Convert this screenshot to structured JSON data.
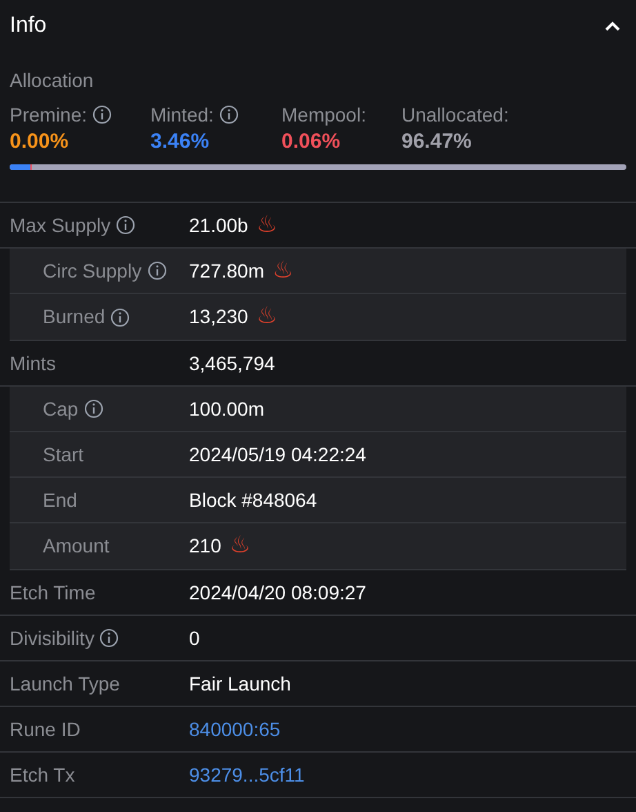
{
  "header": {
    "title": "Info",
    "expanded": true
  },
  "allocation": {
    "label": "Allocation",
    "items": [
      {
        "label": "Premine:",
        "info": true,
        "value": "0.00%",
        "color": "#f7931a"
      },
      {
        "label": "Minted:",
        "info": true,
        "value": "3.46%",
        "color": "#3b82f6"
      },
      {
        "label": "Mempool:",
        "info": false,
        "value": "0.06%",
        "color": "#f0505a"
      },
      {
        "label": "Unallocated:",
        "info": false,
        "value": "96.47%",
        "color": "#a1a1aa"
      }
    ],
    "bar": [
      {
        "color": "#3b82f6",
        "level": 0.0346
      },
      {
        "color": "#f0505a",
        "level": 0.0006
      }
    ]
  },
  "rows": [
    {
      "label": "Max Supply",
      "info": true,
      "value": "21.00b",
      "symbol": "♨",
      "children": [
        {
          "label": "Circ Supply",
          "info": true,
          "value": "727.80m",
          "symbol": "♨"
        },
        {
          "label": "Burned",
          "info": true,
          "value": "13,230",
          "symbol": "♨"
        }
      ]
    },
    {
      "label": "Mints",
      "info": false,
      "value": "3,465,794",
      "children": [
        {
          "label": "Cap",
          "info": true,
          "value": "100.00m"
        },
        {
          "label": "Start",
          "info": false,
          "value": "2024/05/19 04:22:24"
        },
        {
          "label": "End",
          "info": false,
          "value": "Block #848064"
        },
        {
          "label": "Amount",
          "info": false,
          "value": "210",
          "symbol": "♨"
        }
      ]
    },
    {
      "label": "Etch Time",
      "info": false,
      "value": "2024/04/20 08:09:27"
    },
    {
      "label": "Divisibility",
      "info": true,
      "value": "0"
    },
    {
      "label": "Launch Type",
      "info": false,
      "value": "Fair Launch"
    },
    {
      "label": "Rune ID",
      "info": false,
      "value": "840000:65",
      "kind": "link"
    },
    {
      "label": "Etch Tx",
      "info": false,
      "value": "93279...5cf11",
      "kind": "link"
    }
  ]
}
